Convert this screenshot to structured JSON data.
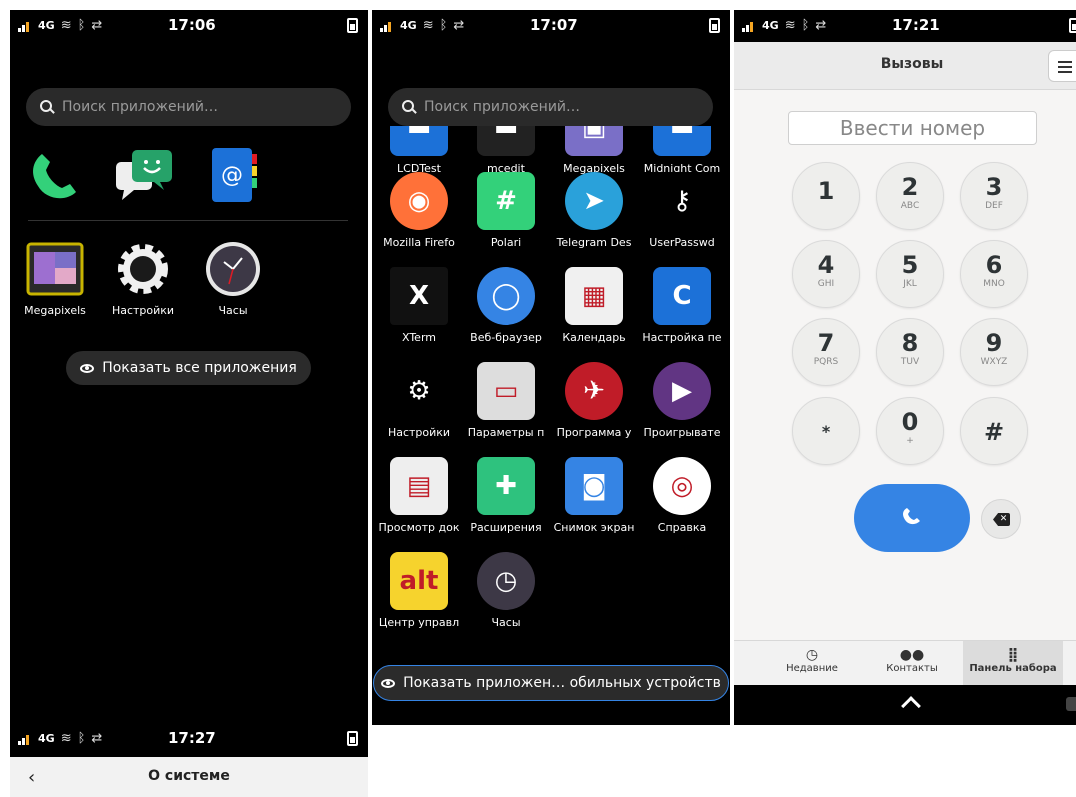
{
  "panel1": {
    "status": {
      "network": "4G",
      "time": "17:06"
    },
    "search_placeholder": "Поиск приложений…",
    "favorites": [
      "phone-icon",
      "chat-icon",
      "contacts-icon"
    ],
    "apps": [
      {
        "label": "Megapixels",
        "icon": "megapixels-icon"
      },
      {
        "label": "Настройки",
        "icon": "settings-gear-icon"
      },
      {
        "label": "Часы",
        "icon": "clock-icon"
      }
    ],
    "show_all_label": "Показать все приложения",
    "status_bottom": {
      "network": "4G",
      "time": "17:27"
    },
    "bottom_title": "О системе"
  },
  "panel2": {
    "status": {
      "network": "4G",
      "time": "17:07"
    },
    "search_placeholder": "Поиск приложений…",
    "apps": [
      {
        "label": "LCDTest",
        "icon": "lcdtest-icon"
      },
      {
        "label": "mcedit",
        "icon": "mcedit-icon"
      },
      {
        "label": "Megapixels",
        "icon": "megapixels-icon"
      },
      {
        "label": "Midnight Com",
        "icon": "midnight-commander-icon"
      },
      {
        "label": "Mozilla Firefo",
        "icon": "firefox-icon"
      },
      {
        "label": "Polari",
        "icon": "polari-icon"
      },
      {
        "label": "Telegram Des",
        "icon": "telegram-icon"
      },
      {
        "label": "UserPasswd",
        "icon": "keys-icon"
      },
      {
        "label": "XTerm",
        "icon": "xterm-icon"
      },
      {
        "label": "Веб-браузер",
        "icon": "web-browser-icon"
      },
      {
        "label": "Календарь",
        "icon": "calendar-icon"
      },
      {
        "label": "Настройка пе",
        "icon": "control-icon"
      },
      {
        "label": "Настройки",
        "icon": "settings-gear-icon"
      },
      {
        "label": "Параметры п",
        "icon": "printer-icon"
      },
      {
        "label": "Программа у",
        "icon": "software-icon"
      },
      {
        "label": "Проигрывате",
        "icon": "media-player-icon"
      },
      {
        "label": "Просмотр док",
        "icon": "document-viewer-icon"
      },
      {
        "label": "Расширения",
        "icon": "extensions-icon"
      },
      {
        "label": "Снимок экран",
        "icon": "screenshot-icon"
      },
      {
        "label": "Справка",
        "icon": "help-lifebuoy-icon"
      },
      {
        "label": "Центр управл",
        "icon": "basealt-icon"
      },
      {
        "label": "Часы",
        "icon": "clock-icon"
      }
    ],
    "show_mobile_label": "Показать приложен… обильных устройств"
  },
  "panel3": {
    "status": {
      "network": "4G",
      "time": "17:21"
    },
    "title": "Вызовы",
    "number_placeholder": "Ввести номер",
    "keys": [
      {
        "digit": "1",
        "sub": ""
      },
      {
        "digit": "2",
        "sub": "ABC"
      },
      {
        "digit": "3",
        "sub": "DEF"
      },
      {
        "digit": "4",
        "sub": "GHI"
      },
      {
        "digit": "5",
        "sub": "JKL"
      },
      {
        "digit": "6",
        "sub": "MNO"
      },
      {
        "digit": "7",
        "sub": "PQRS"
      },
      {
        "digit": "8",
        "sub": "TUV"
      },
      {
        "digit": "9",
        "sub": "WXYZ"
      },
      {
        "digit": "*",
        "sub": ""
      },
      {
        "digit": "0",
        "sub": "+"
      },
      {
        "digit": "#",
        "sub": ""
      }
    ],
    "tabs": [
      {
        "label": "Недавние",
        "icon": "recent-clock-icon"
      },
      {
        "label": "Контакты",
        "icon": "contacts-people-icon"
      },
      {
        "label": "Панель набора",
        "icon": "dialpad-icon"
      }
    ]
  }
}
